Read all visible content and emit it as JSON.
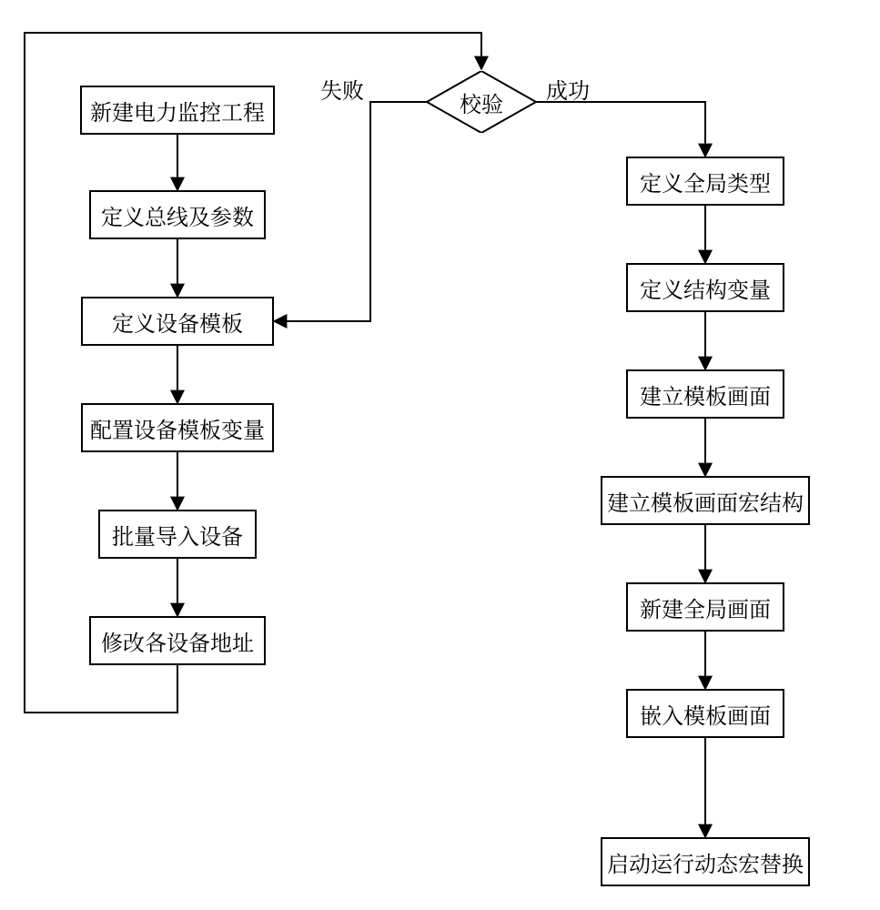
{
  "flow": {
    "left": {
      "n1": "新建电力监控工程",
      "n2": "定义总线及参数",
      "n3": "定义设备模板",
      "n4": "配置设备模板变量",
      "n5": "批量导入设备",
      "n6": "修改各设备地址"
    },
    "decision": {
      "label": "校验",
      "fail": "失败",
      "success": "成功"
    },
    "right": {
      "r1": "定义全局类型",
      "r2": "定义结构变量",
      "r3": "建立模板画面",
      "r4": "建立模板画面宏结构",
      "r5": "新建全局画面",
      "r6": "嵌入模板画面",
      "r7": "启动运行动态宏替换"
    }
  }
}
